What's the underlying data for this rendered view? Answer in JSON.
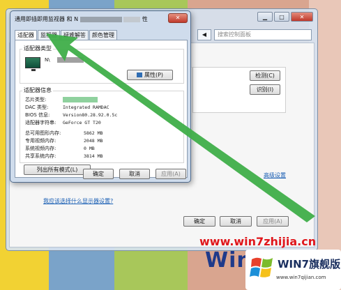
{
  "background_window": {
    "search_placeholder": "搜索控制面板",
    "minimize": "▁",
    "maximize": "□",
    "close": "✕",
    "nav": "◀",
    "detect_button": "检测(C)",
    "identify_button": "识别(I)",
    "advanced_link": "高级设置",
    "help_link": "我应该选择什么显示器设置?",
    "ok_button": "确定",
    "cancel_button": "取消",
    "apply_button": "应用(A)"
  },
  "dialog": {
    "title_prefix": "通用即插即用监视器 和 N",
    "title_suffix": "性",
    "close": "✕",
    "tabs": [
      "适配器",
      "监视器",
      "疑难解答",
      "颜色管理"
    ],
    "adapter_type_label": "适配器类型",
    "adapter_name_prefix": "N\\",
    "properties_button": "属性(P)",
    "adapter_info_label": "适配器信息",
    "info_rows": [
      {
        "k": "芯片类型:",
        "v": ""
      },
      {
        "k": "DAC 类型:",
        "v": "Integrated RAMDAC"
      },
      {
        "k": "BIOS 信息:",
        "v": "Version80.28.92.0.5c"
      },
      {
        "k": "适配器字符串:",
        "v": "GeForce GT T20"
      }
    ],
    "mem_rows": [
      {
        "k": "总可用图形内存:",
        "v": "5862 MB"
      },
      {
        "k": "专用视频内存:",
        "v": "2048 MB"
      },
      {
        "k": "系统视频内存:",
        "v": "0 MB"
      },
      {
        "k": "共享系统内存:",
        "v": "3814 MB"
      }
    ],
    "list_modes_button": "列出所有模式(L)",
    "ok_button": "确定",
    "cancel_button": "取消",
    "apply_button": "应用(A)"
  },
  "watermark": {
    "url": "www.win7zhijia.cn",
    "logo_text": "Win",
    "badge_title": "WIN7旗舰版",
    "badge_url": "www.win7qijian.com"
  },
  "colors": {
    "arrow": "#3fae49",
    "link": "#1a5fb4",
    "watermark_red": "#e0161b"
  }
}
